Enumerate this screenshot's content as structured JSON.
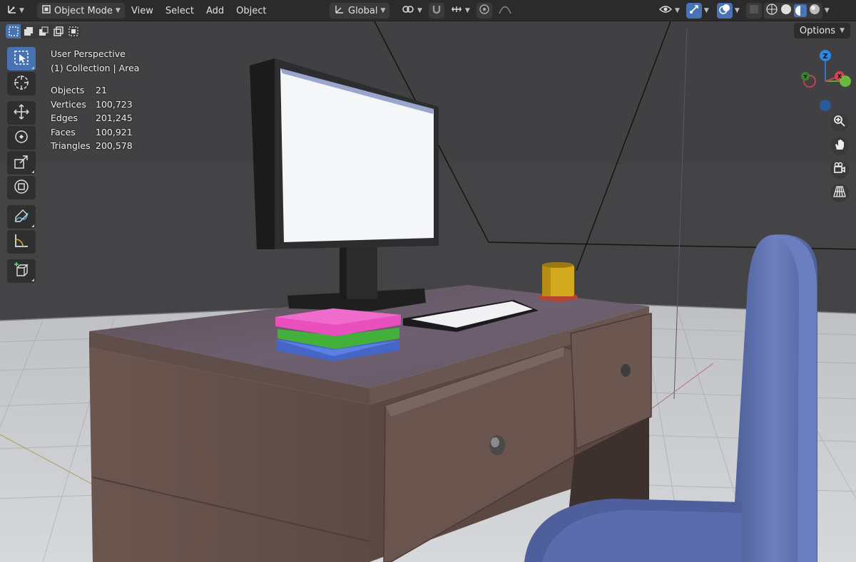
{
  "header": {
    "editor_type_icon": "axes-icon",
    "mode": "Object Mode",
    "menus": [
      "View",
      "Select",
      "Add",
      "Object"
    ],
    "transform_orientation": "Global",
    "accent": "#4772b3"
  },
  "selection_modes": [
    "new",
    "extend",
    "subtract",
    "difference",
    "intersect"
  ],
  "options_label": "Options",
  "overlay": {
    "view_name": "User Perspective",
    "collection": "(1) Collection | Area",
    "stats": [
      {
        "label": "Objects",
        "value": "21"
      },
      {
        "label": "Vertices",
        "value": "100,723"
      },
      {
        "label": "Edges",
        "value": "201,245"
      },
      {
        "label": "Faces",
        "value": "100,921"
      },
      {
        "label": "Triangles",
        "value": "200,578"
      }
    ]
  },
  "toolbar": [
    "select-box",
    "cursor",
    "move",
    "rotate",
    "scale",
    "transform",
    "annotate",
    "measure",
    "add-cube"
  ],
  "gizmo": {
    "z_label": "Z",
    "y_label": "Y",
    "x_label": "X"
  }
}
